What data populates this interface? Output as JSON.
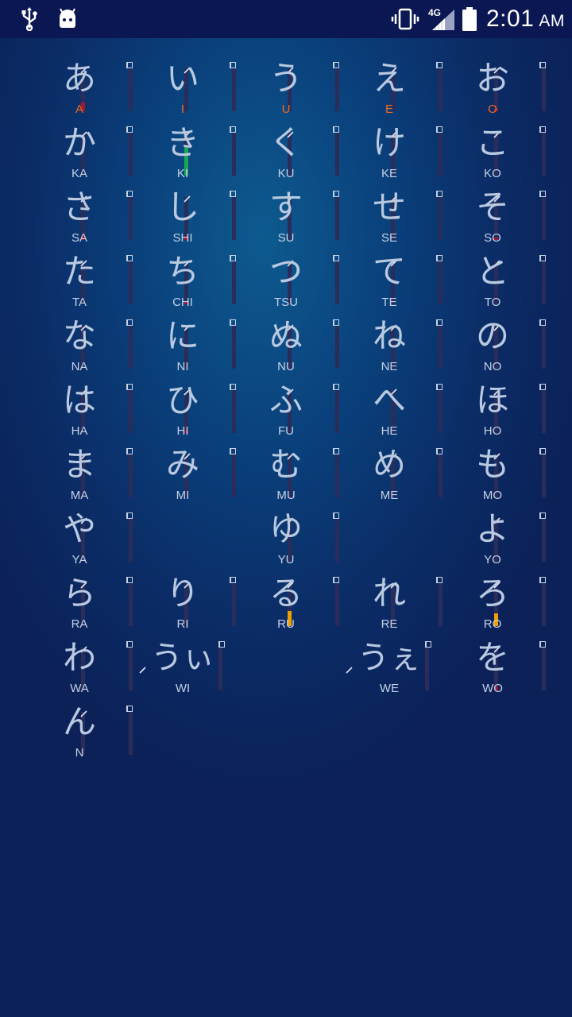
{
  "status_bar": {
    "time": "2:01",
    "ampm": "AM",
    "network": "4G",
    "icons": [
      "usb-icon",
      "android-bot-icon",
      "vibrate-icon",
      "signal-icon",
      "battery-icon"
    ]
  },
  "colors": {
    "progress_red": "#a3182e",
    "progress_green": "#1aa653",
    "progress_orange": "#f0a000",
    "vowel_label": "#f06a1e",
    "bar_track": "#2a2c5a"
  },
  "rows": [
    [
      {
        "kana": "あ",
        "romaji": "A",
        "vowel": true,
        "progress": 0.2,
        "progress_color": "red"
      },
      {
        "kana": "い",
        "romaji": "I",
        "vowel": true,
        "progress": 0,
        "progress_color": "red"
      },
      {
        "kana": "う",
        "romaji": "U",
        "vowel": true,
        "progress": 0,
        "progress_color": "red"
      },
      {
        "kana": "え",
        "romaji": "E",
        "vowel": true,
        "progress": 0,
        "progress_color": "red"
      },
      {
        "kana": "お",
        "romaji": "O",
        "vowel": true,
        "progress": 0.05,
        "progress_color": "red"
      }
    ],
    [
      {
        "kana": "か",
        "romaji": "KA",
        "progress": 0,
        "progress_color": "red"
      },
      {
        "kana": "き",
        "romaji": "KI",
        "progress": 0.7,
        "progress_color": "green"
      },
      {
        "kana": "く",
        "romaji": "KU",
        "progress": 0,
        "progress_color": "red"
      },
      {
        "kana": "け",
        "romaji": "KE",
        "progress": 0,
        "progress_color": "red"
      },
      {
        "kana": "こ",
        "romaji": "KO",
        "progress": 0,
        "progress_color": "red"
      }
    ],
    [
      {
        "kana": "さ",
        "romaji": "SA",
        "progress": 0.1,
        "progress_color": "red"
      },
      {
        "kana": "し",
        "romaji": "SHI",
        "progress": 0.1,
        "progress_color": "red"
      },
      {
        "kana": "す",
        "romaji": "SU",
        "progress": 0,
        "progress_color": "red"
      },
      {
        "kana": "せ",
        "romaji": "SE",
        "progress": 0,
        "progress_color": "red"
      },
      {
        "kana": "そ",
        "romaji": "SO",
        "progress": 0.05,
        "progress_color": "red"
      }
    ],
    [
      {
        "kana": "た",
        "romaji": "TA",
        "progress": 0,
        "progress_color": "red"
      },
      {
        "kana": "ち",
        "romaji": "CHI",
        "progress": 0.05,
        "progress_color": "red"
      },
      {
        "kana": "つ",
        "romaji": "TSU",
        "progress": 0,
        "progress_color": "red"
      },
      {
        "kana": "て",
        "romaji": "TE",
        "progress": 0,
        "progress_color": "red"
      },
      {
        "kana": "と",
        "romaji": "TO",
        "progress": 0,
        "progress_color": "red"
      }
    ],
    [
      {
        "kana": "な",
        "romaji": "NA",
        "progress": 0,
        "progress_color": "red"
      },
      {
        "kana": "に",
        "romaji": "NI",
        "progress": 0,
        "progress_color": "red"
      },
      {
        "kana": "ぬ",
        "romaji": "NU",
        "progress": 0,
        "progress_color": "red"
      },
      {
        "kana": "ね",
        "romaji": "NE",
        "progress": 0,
        "progress_color": "red"
      },
      {
        "kana": "の",
        "romaji": "NO",
        "progress": 0,
        "progress_color": "red"
      }
    ],
    [
      {
        "kana": "は",
        "romaji": "HA",
        "progress": 0,
        "progress_color": "red"
      },
      {
        "kana": "ひ",
        "romaji": "HI",
        "progress": 0.05,
        "progress_color": "red"
      },
      {
        "kana": "ふ",
        "romaji": "FU",
        "progress": 0,
        "progress_color": "red"
      },
      {
        "kana": "へ",
        "romaji": "HE",
        "progress": 0,
        "progress_color": "red"
      },
      {
        "kana": "ほ",
        "romaji": "HO",
        "progress": 0,
        "progress_color": "red"
      }
    ],
    [
      {
        "kana": "ま",
        "romaji": "MA",
        "progress": 0,
        "progress_color": "red"
      },
      {
        "kana": "み",
        "romaji": "MI",
        "progress": 0,
        "progress_color": "red"
      },
      {
        "kana": "む",
        "romaji": "MU",
        "progress": 0,
        "progress_color": "red"
      },
      {
        "kana": "め",
        "romaji": "ME",
        "progress": 0,
        "progress_color": "red"
      },
      {
        "kana": "も",
        "romaji": "MO",
        "progress": 0,
        "progress_color": "red"
      }
    ],
    [
      {
        "kana": "や",
        "romaji": "YA",
        "progress": 0,
        "progress_color": "red"
      },
      null,
      {
        "kana": "ゆ",
        "romaji": "YU",
        "progress": 0,
        "progress_color": "red"
      },
      null,
      {
        "kana": "よ",
        "romaji": "YO",
        "progress": 0,
        "progress_color": "red"
      }
    ],
    [
      {
        "kana": "ら",
        "romaji": "RA",
        "progress": 0,
        "progress_color": "red"
      },
      {
        "kana": "り",
        "romaji": "RI",
        "progress": 0,
        "progress_color": "red"
      },
      {
        "kana": "る",
        "romaji": "RU",
        "progress": 0.35,
        "progress_color": "orange"
      },
      {
        "kana": "れ",
        "romaji": "RE",
        "progress": 0,
        "progress_color": "red"
      },
      {
        "kana": "ろ",
        "romaji": "RO",
        "progress": 0.3,
        "progress_color": "orange"
      }
    ],
    [
      {
        "kana": "わ",
        "romaji": "WA",
        "progress": 0,
        "progress_color": "red"
      },
      {
        "kana": "うぃ",
        "romaji": "WI",
        "wide": true,
        "progress": 0,
        "progress_color": "red"
      },
      null,
      {
        "kana": "うぇ",
        "romaji": "WE",
        "wide": true,
        "progress": 0,
        "progress_color": "red"
      },
      {
        "kana": "を",
        "romaji": "WO",
        "progress": 0.1,
        "progress_color": "red"
      }
    ],
    [
      {
        "kana": "ん",
        "romaji": "N",
        "progress": 0,
        "progress_color": "red"
      },
      null,
      null,
      null,
      null
    ]
  ]
}
